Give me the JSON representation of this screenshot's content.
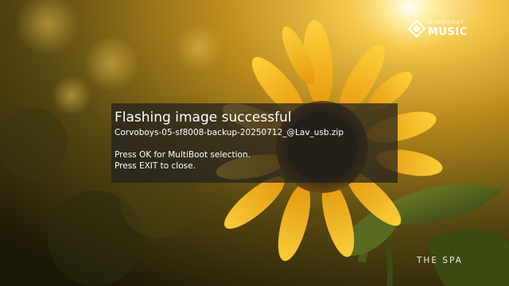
{
  "brand": {
    "line1": "OPENGRAY",
    "line2": "MUSIC"
  },
  "dialog": {
    "title": "Flashing image successful",
    "filename": "Corvoboys-05-sf8008-backup-20250712_@Lav_usb.zip",
    "instruction_ok": "Press OK for MultiBoot selection.",
    "instruction_exit": "Press EXIT to close."
  },
  "channel": {
    "name": "THE SPA"
  },
  "colors": {
    "dialog_background": "#1e1e1e",
    "dialog_text": "#ffffff",
    "petal": "#f2b31a",
    "flower_center": "#3a2a10"
  },
  "icons": {
    "brand_logo": "diamond-logo-icon"
  }
}
